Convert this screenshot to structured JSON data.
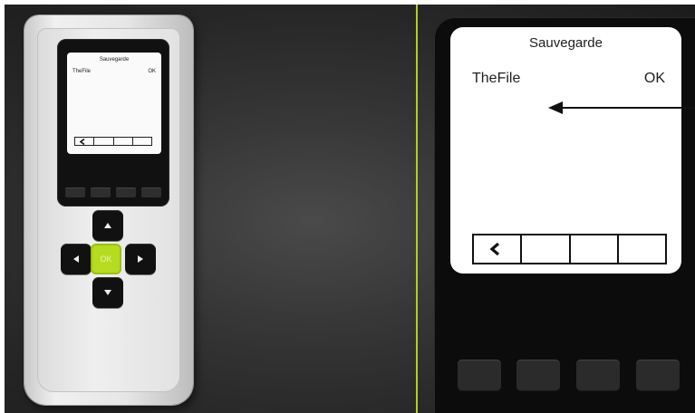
{
  "mini_screen": {
    "title": "Sauvegarde",
    "filename": "TheFile",
    "status": "OK"
  },
  "keypad": {
    "ok_label": "OK"
  },
  "zoom_screen": {
    "title": "Sauvegarde",
    "filename": "TheFile",
    "status": "OK"
  },
  "icons": {
    "back": "chevron-left-icon",
    "up": "arrow-up-icon",
    "down": "arrow-down-icon",
    "left": "arrow-left-icon",
    "right": "arrow-right-icon",
    "pointer": "pointer-arrow-icon"
  },
  "colors": {
    "accent": "#b5dc1f",
    "divider": "#b6cc22",
    "device_body": "#e6e6e6",
    "device_face": "#111111"
  }
}
